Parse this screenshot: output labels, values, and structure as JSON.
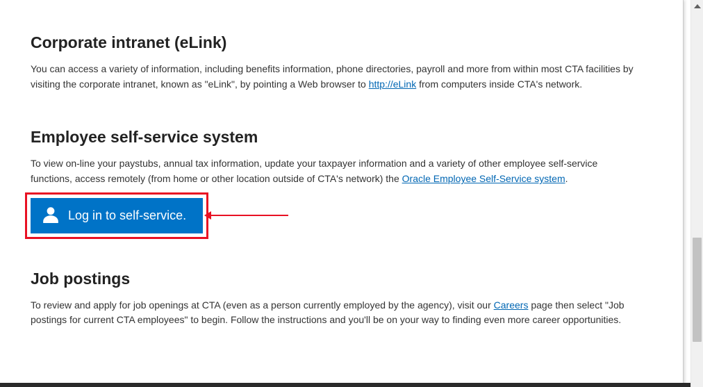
{
  "sections": {
    "intranet": {
      "heading": "Corporate intranet (eLink)",
      "text_before": "You can access a variety of information, including benefits information, phone directories, payroll and more from within most CTA facilities by visiting the corporate intranet, known as \"eLink\", by pointing a Web browser to ",
      "link_label": "http://eLink",
      "text_after": " from computers inside CTA's network."
    },
    "selfservice": {
      "heading": "Employee self-service system",
      "text_before": "To view on-line your paystubs, annual tax information, update your taxpayer information and a variety of other employee self-service functions, access remotely (from home or other location outside of CTA's network) the ",
      "link_label": "Oracle Employee Self-Service system",
      "text_after": ".",
      "button_label": "Log in to self-service."
    },
    "jobs": {
      "heading": "Job postings",
      "text_before": "To review and apply for job openings at CTA (even as a person currently employed by the agency), visit our ",
      "link_label": "Careers",
      "text_after": " page then select \"Job postings for current CTA employees\" to begin. Follow the instructions and you'll be on your way to finding even more career opportunities."
    }
  }
}
